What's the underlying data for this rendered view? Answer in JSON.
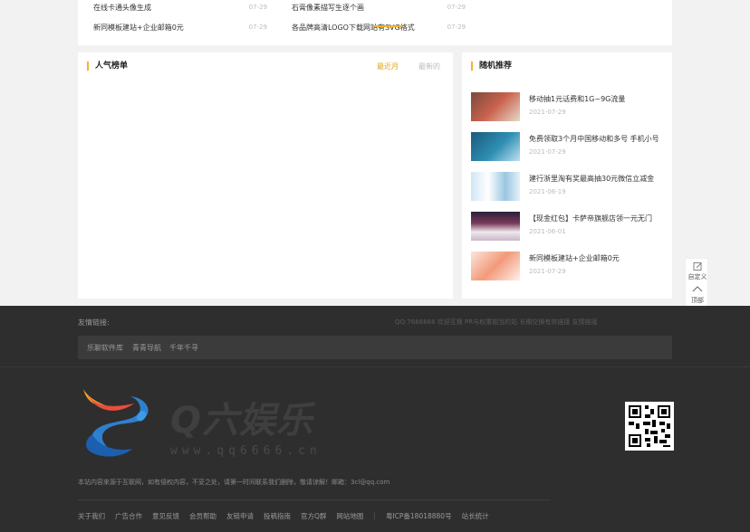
{
  "news": [
    {
      "title": "在线卡通头像生成",
      "date": "07-29"
    },
    {
      "title": "石膏像素描写生逐个画",
      "date": "07-29"
    },
    {
      "title": "新同模板建站+企业邮箱0元",
      "date": "07-29"
    },
    {
      "title": "各品牌高清LOGO下载网站有SVG格式",
      "date": "07-29"
    }
  ],
  "ranking": {
    "title": "人气榜单",
    "tabs": [
      "最近月",
      "最新的"
    ]
  },
  "recommend": {
    "title": "随机推荐",
    "items": [
      {
        "title": "移动抽1元话费和1G~9G流量",
        "date": "2021-07-29"
      },
      {
        "title": "免费领取3个月中国移动和多号 手机小号",
        "date": "2021-07-29"
      },
      {
        "title": "建行浙里淘有奖最高抽30元微信立减金",
        "date": "2021-06-19"
      },
      {
        "title": "【现金红包】卡萨帝旗舰店领一元无门",
        "date": "2021-06-01"
      },
      {
        "title": "新同模板建站+企业邮箱0元",
        "date": "2021-07-29"
      }
    ]
  },
  "float": {
    "custom": "自定义",
    "top": "顶部"
  },
  "footer": {
    "friend_label": "友情链接:",
    "friend_hint": "QQ:7666666 欢迎互换 PR与权重相当的站 长期交换有效链接 友情链接",
    "friend_links": [
      "乐聊软件库",
      "青青导航",
      "千年千寻"
    ],
    "logo_text": "Q六娱乐",
    "logo_url": "www.qq6666.cn",
    "notice": "本站内容来源于互联网，如有侵权内容，不妥之处，请第一时间联系我们删除，敬请谅解！邮箱：3cl@qq.com",
    "bottom_links": [
      "关于我们",
      "广告合作",
      "意见反馈",
      "会员帮助",
      "友链申请",
      "投稿指南",
      "官方Q群",
      "网站地图"
    ],
    "icp": "粤ICP备18018880号",
    "stats": "站长统计"
  },
  "colors": {
    "accent": "#f0b429",
    "footer_bg": "#2e2e2e"
  }
}
